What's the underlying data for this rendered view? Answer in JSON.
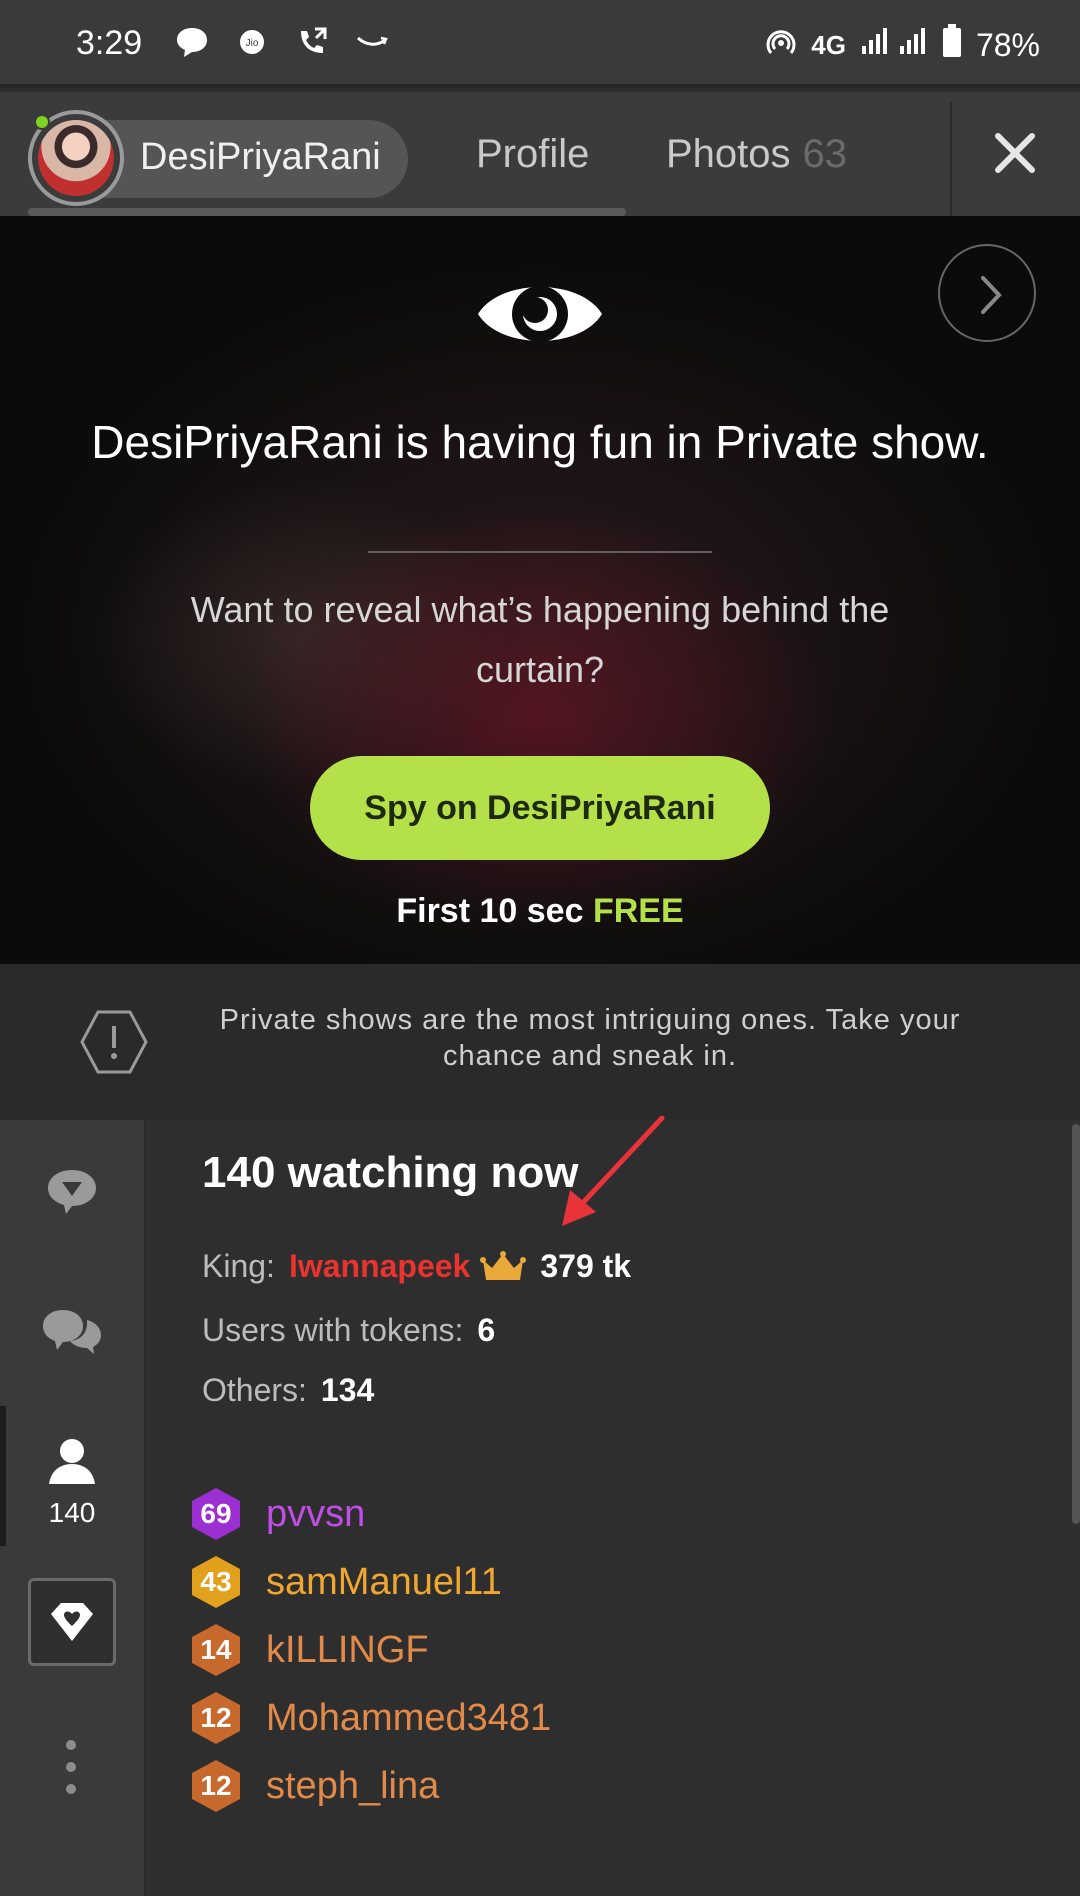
{
  "status_bar": {
    "time": "3:29",
    "network": "4G",
    "battery": "78%",
    "icons": [
      "chat-bubble-icon",
      "jio-icon",
      "call-forward-icon",
      "amazon-icon",
      "hotspot-icon",
      "signal-icon",
      "battery-icon"
    ]
  },
  "header": {
    "model_name": "DesiPriyaRani",
    "tabs": [
      {
        "label": "Profile"
      },
      {
        "label": "Photos",
        "count": "63"
      }
    ],
    "online_color": "#7ed321"
  },
  "private_show": {
    "title": "DesiPriyaRani is having fun in Private show.",
    "subtitle": "Want to reveal what’s happening behind the curtain?",
    "spy_button": "Spy on DesiPriyaRani",
    "free_prefix": "First 10 sec",
    "free_word": "FREE",
    "accent": "#b4e049"
  },
  "info": {
    "text": "Private shows are the most intriguing ones. Take your chance and sneak in."
  },
  "sidebar": {
    "viewer_count": "140"
  },
  "users": {
    "watching": "140 watching now",
    "king_label": "King:",
    "king_name": "Iwannapeek",
    "king_tokens": "379 tk",
    "with_tokens_label": "Users with tokens:",
    "with_tokens_value": "6",
    "others_label": "Others:",
    "others_value": "134",
    "list": [
      {
        "level": "69",
        "name": "pvvsn",
        "color": "#c04ee6",
        "badge": "#9b2fd1"
      },
      {
        "level": "43",
        "name": "samManuel11",
        "color": "#f0a730",
        "badge": "#e2a11c"
      },
      {
        "level": "14",
        "name": "kILLINGF",
        "color": "#e28a4a",
        "badge": "#c7692c"
      },
      {
        "level": "12",
        "name": "Mohammed3481",
        "color": "#e28a4a",
        "badge": "#c7692c"
      },
      {
        "level": "12",
        "name": "steph_lina",
        "color": "#e28a4a",
        "badge": "#c7692c"
      }
    ]
  }
}
